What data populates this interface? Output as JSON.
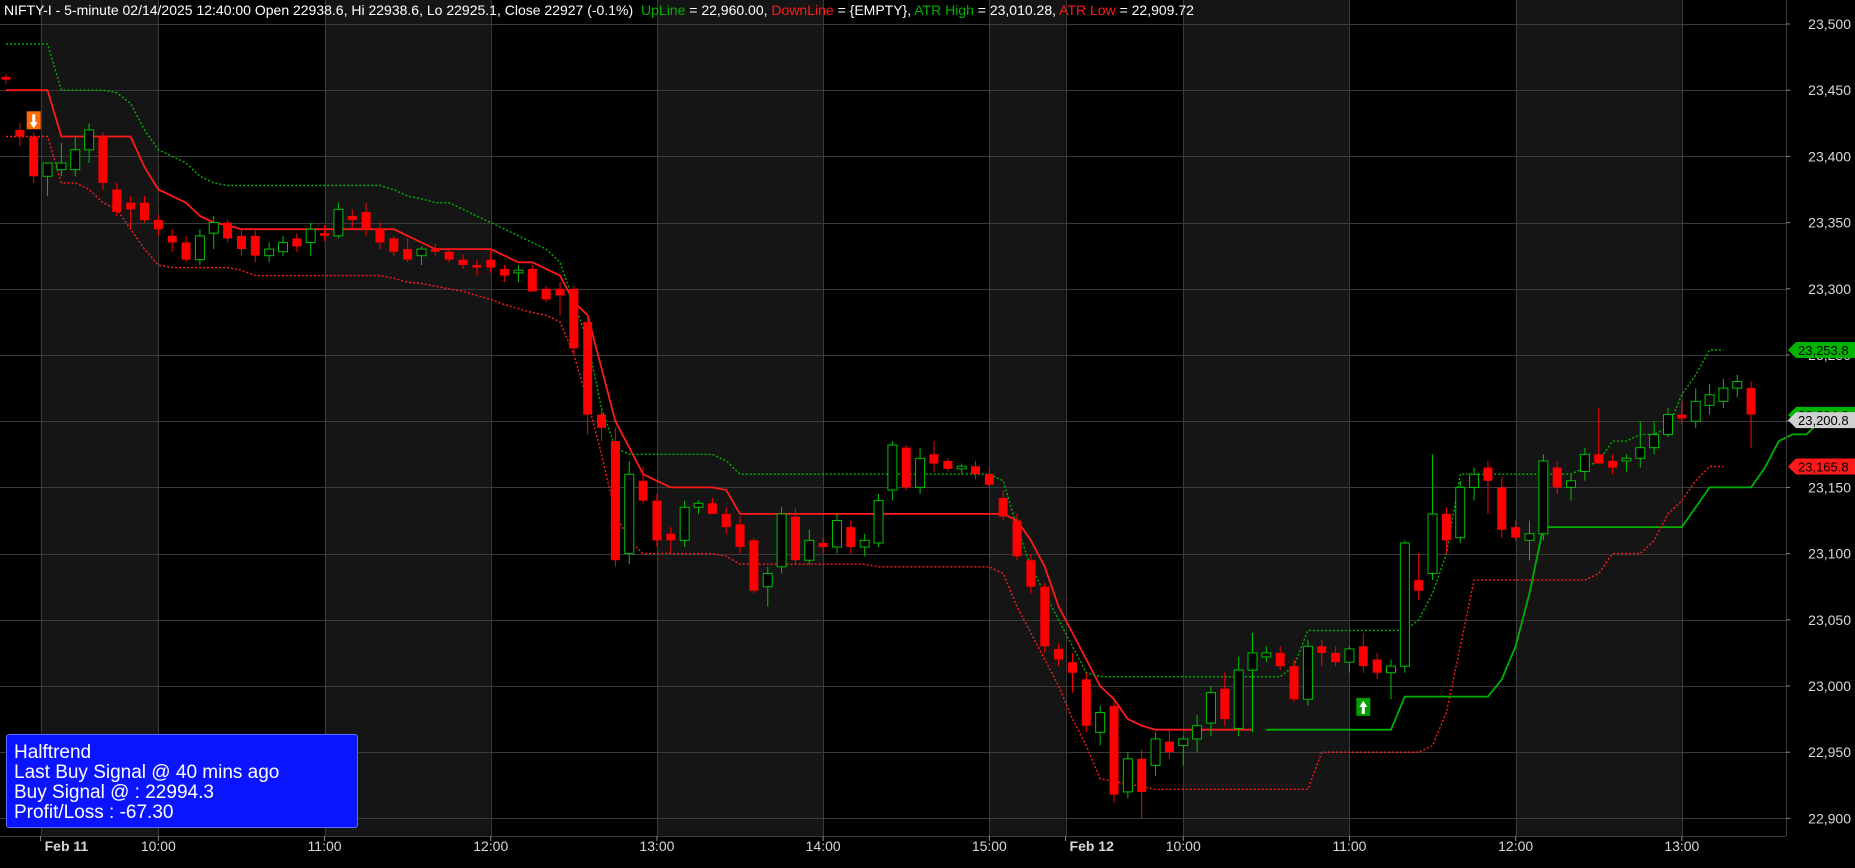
{
  "header": {
    "symbol_line": "NIFTY-I - 5-minute 02/14/2025 12:40:00 Open 22938.6, Hi 22938.6, Lo 22925.1, Close 22927 (-0.1%)",
    "upline_label": "UpLine",
    "upline_value": " = 22,960.00, ",
    "downline_label": "DownLine",
    "downline_value": " = {EMPTY}, ",
    "atrhigh_label": "ATR High",
    "atrhigh_value": " = 23,010.28, ",
    "atrlow_label": "ATR Low",
    "atrlow_value": " = 22,909.72"
  },
  "info_box": {
    "title": "Halftrend",
    "line1": "Last Buy Signal @ 40 mins ago",
    "line2": "Buy Signal @  : 22994.3",
    "line3": "Profit/Loss : -67.30"
  },
  "colors": {
    "background": "#000000",
    "band_alt": "#151515",
    "grid": "#3a3a3a",
    "bull": "#00c000",
    "bear": "#ff0000",
    "upline": "#00b000",
    "downline": "#ff1a1a",
    "atr_high": "#00b400",
    "atr_low": "#ff1a1a",
    "info_bg": "#0a14ff",
    "text": "#d8d8d8"
  },
  "chart_data": {
    "type": "candlestick",
    "title": "NIFTY-I - 5-minute",
    "y_ticks": [
      "23,500",
      "23,450",
      "23,400",
      "23,350",
      "23,300",
      "23,250",
      "23,200",
      "23,150",
      "23,100",
      "23,050",
      "23,000",
      "22,950",
      "22,900"
    ],
    "y_tick_values": [
      23500,
      23450,
      23400,
      23350,
      23300,
      23250,
      23200,
      23150,
      23100,
      23050,
      23000,
      22950,
      22900
    ],
    "ylim": [
      22888,
      23515
    ],
    "x_tick_labels": [
      {
        "label": "Feb 11",
        "bar": 2.5,
        "bold": true
      },
      {
        "label": "10:00",
        "bar": 11
      },
      {
        "label": "11:00",
        "bar": 23
      },
      {
        "label": "12:00",
        "bar": 35
      },
      {
        "label": "13:00",
        "bar": 47
      },
      {
        "label": "14:00",
        "bar": 59
      },
      {
        "label": "15:00",
        "bar": 71
      },
      {
        "label": "Feb 12",
        "bar": 76.5,
        "bold": true
      },
      {
        "label": "10:00",
        "bar": 85
      },
      {
        "label": "11:00",
        "bar": 97
      },
      {
        "label": "12:00",
        "bar": 109
      },
      {
        "label": "13:00",
        "bar": 121
      }
    ],
    "right_tags": [
      {
        "text": "23,253.8",
        "value": 23253.8,
        "bg": "#00b400",
        "fg": "#000000"
      },
      {
        "text": "23,204.8",
        "value": 23204.8,
        "bg": "#00b400",
        "fg": "#000000"
      },
      {
        "text": "23,200.8",
        "value": 23200.8,
        "bg": "#d0d0d0",
        "fg": "#000000"
      },
      {
        "text": "23,165.8",
        "value": 23165.8,
        "bg": "#ff1a1a",
        "fg": "#000000"
      }
    ],
    "signals": [
      {
        "type": "sell",
        "bar": 2,
        "value": 23425
      },
      {
        "type": "buy",
        "bar": 98,
        "value": 22985
      }
    ],
    "candles": [
      [
        23460,
        23462,
        23455,
        23458
      ],
      [
        23420,
        23425,
        23408,
        23415
      ],
      [
        23415,
        23418,
        23380,
        23385
      ],
      [
        23385,
        23395,
        23370,
        23395
      ],
      [
        23390,
        23410,
        23385,
        23395
      ],
      [
        23390,
        23415,
        23385,
        23405
      ],
      [
        23405,
        23425,
        23395,
        23420
      ],
      [
        23415,
        23418,
        23375,
        23380
      ],
      [
        23375,
        23380,
        23355,
        23358
      ],
      [
        23365,
        23370,
        23345,
        23360
      ],
      [
        23365,
        23370,
        23350,
        23352
      ],
      [
        23352,
        23356,
        23340,
        23345
      ],
      [
        23340,
        23345,
        23328,
        23335
      ],
      [
        23335,
        23340,
        23320,
        23322
      ],
      [
        23322,
        23345,
        23318,
        23340
      ],
      [
        23342,
        23355,
        23330,
        23350
      ],
      [
        23350,
        23352,
        23335,
        23338
      ],
      [
        23340,
        23345,
        23325,
        23330
      ],
      [
        23340,
        23344,
        23320,
        23325
      ],
      [
        23325,
        23335,
        23320,
        23330
      ],
      [
        23328,
        23340,
        23325,
        23335
      ],
      [
        23338,
        23342,
        23328,
        23332
      ],
      [
        23335,
        23350,
        23325,
        23345
      ],
      [
        23342,
        23348,
        23336,
        23340
      ],
      [
        23340,
        23365,
        23338,
        23360
      ],
      [
        23355,
        23360,
        23345,
        23352
      ],
      [
        23358,
        23365,
        23340,
        23345
      ],
      [
        23345,
        23350,
        23330,
        23335
      ],
      [
        23338,
        23340,
        23325,
        23328
      ],
      [
        23330,
        23338,
        23320,
        23322
      ],
      [
        23325,
        23332,
        23318,
        23330
      ],
      [
        23330,
        23334,
        23325,
        23328
      ],
      [
        23328,
        23330,
        23320,
        23322
      ],
      [
        23322,
        23326,
        23315,
        23318
      ],
      [
        23318,
        23322,
        23310,
        23316
      ],
      [
        23322,
        23330,
        23312,
        23316
      ],
      [
        23315,
        23318,
        23305,
        23310
      ],
      [
        23312,
        23318,
        23305,
        23314
      ],
      [
        23315,
        23318,
        23298,
        23298
      ],
      [
        23300,
        23302,
        23290,
        23292
      ],
      [
        23300,
        23305,
        23280,
        23295
      ],
      [
        23300,
        23302,
        23250,
        23255
      ],
      [
        23275,
        23280,
        23190,
        23205
      ],
      [
        23205,
        23210,
        23185,
        23195
      ],
      [
        23185,
        23195,
        23090,
        23095
      ],
      [
        23100,
        23170,
        23092,
        23160
      ],
      [
        23155,
        23165,
        23138,
        23140
      ],
      [
        23140,
        23145,
        23105,
        23110
      ],
      [
        23115,
        23120,
        23100,
        23110
      ],
      [
        23110,
        23140,
        23105,
        23135
      ],
      [
        23135,
        23140,
        23130,
        23138
      ],
      [
        23138,
        23142,
        23130,
        23130
      ],
      [
        23130,
        23135,
        23115,
        23120
      ],
      [
        23122,
        23128,
        23100,
        23105
      ],
      [
        23110,
        23112,
        23070,
        23072
      ],
      [
        23075,
        23090,
        23060,
        23085
      ],
      [
        23090,
        23135,
        23085,
        23130
      ],
      [
        23128,
        23134,
        23092,
        23095
      ],
      [
        23095,
        23118,
        23092,
        23110
      ],
      [
        23108,
        23112,
        23100,
        23105
      ],
      [
        23105,
        23130,
        23100,
        23125
      ],
      [
        23120,
        23125,
        23100,
        23105
      ],
      [
        23105,
        23115,
        23098,
        23110
      ],
      [
        23108,
        23145,
        23105,
        23140
      ],
      [
        23148,
        23185,
        23140,
        23182
      ],
      [
        23180,
        23182,
        23148,
        23150
      ],
      [
        23150,
        23180,
        23145,
        23172
      ],
      [
        23175,
        23185,
        23162,
        23168
      ],
      [
        23170,
        23172,
        23162,
        23164
      ],
      [
        23164,
        23168,
        23160,
        23166
      ],
      [
        23166,
        23170,
        23156,
        23160
      ],
      [
        23160,
        23164,
        23150,
        23152
      ],
      [
        23142,
        23148,
        23125,
        23128
      ],
      [
        23125,
        23130,
        23095,
        23098
      ],
      [
        23095,
        23100,
        23070,
        23075
      ],
      [
        23075,
        23078,
        23025,
        23030
      ],
      [
        23028,
        23032,
        23015,
        23020
      ],
      [
        23018,
        23025,
        22995,
        23010
      ],
      [
        23005,
        23010,
        22965,
        22970
      ],
      [
        22965,
        22985,
        22955,
        22980
      ],
      [
        22985,
        22988,
        22912,
        22918
      ],
      [
        22920,
        22950,
        22915,
        22945
      ],
      [
        22945,
        22952,
        22900,
        22920
      ],
      [
        22940,
        22965,
        22932,
        22960
      ],
      [
        22958,
        22968,
        22945,
        22950
      ],
      [
        22955,
        22962,
        22940,
        22960
      ],
      [
        22960,
        22978,
        22950,
        22970
      ],
      [
        22972,
        23000,
        22962,
        22995
      ],
      [
        22998,
        23010,
        22970,
        22975
      ],
      [
        22968,
        23022,
        22962,
        23012
      ],
      [
        23012,
        23040,
        22965,
        23025
      ],
      [
        23022,
        23030,
        23018,
        23025
      ],
      [
        23025,
        23030,
        23012,
        23015
      ],
      [
        23015,
        23020,
        22988,
        22990
      ],
      [
        22990,
        23035,
        22985,
        23030
      ],
      [
        23030,
        23035,
        23015,
        23025
      ],
      [
        23025,
        23030,
        23015,
        23018
      ],
      [
        23018,
        23030,
        23010,
        23028
      ],
      [
        23030,
        23040,
        23010,
        23015
      ],
      [
        23020,
        23025,
        23005,
        23010
      ],
      [
        23010,
        23020,
        22990,
        23015
      ],
      [
        23015,
        23110,
        23010,
        23108
      ],
      [
        23080,
        23100,
        23065,
        23072
      ],
      [
        23085,
        23175,
        23080,
        23130
      ],
      [
        23130,
        23135,
        23100,
        23110
      ],
      [
        23112,
        23155,
        23108,
        23150
      ],
      [
        23150,
        23165,
        23140,
        23160
      ],
      [
        23165,
        23170,
        23130,
        23155
      ],
      [
        23150,
        23158,
        23112,
        23118
      ],
      [
        23120,
        23125,
        23110,
        23112
      ],
      [
        23110,
        23125,
        23095,
        23115
      ],
      [
        23115,
        23175,
        23110,
        23170
      ],
      [
        23165,
        23170,
        23145,
        23150
      ],
      [
        23150,
        23160,
        23140,
        23155
      ],
      [
        23162,
        23180,
        23155,
        23175
      ],
      [
        23175,
        23210,
        23170,
        23168
      ],
      [
        23170,
        23175,
        23160,
        23165
      ],
      [
        23170,
        23175,
        23162,
        23172
      ],
      [
        23172,
        23200,
        23165,
        23180
      ],
      [
        23180,
        23200,
        23175,
        23190
      ],
      [
        23190,
        23210,
        23188,
        23205
      ],
      [
        23205,
        23215,
        23198,
        23202
      ],
      [
        23200,
        23225,
        23195,
        23215
      ],
      [
        23212,
        23228,
        23205,
        23220
      ],
      [
        23215,
        23232,
        23210,
        23225
      ],
      [
        23225,
        23235,
        23218,
        23230
      ],
      [
        23225,
        23230,
        23180,
        23205
      ]
    ],
    "series": [
      {
        "name": "UpLine",
        "style": "solid",
        "color": "#00b000",
        "start": 91,
        "values": [
          22967,
          22967,
          22967,
          22967,
          22967,
          22967,
          22967,
          22967,
          22967,
          22967,
          22992,
          22992,
          22992,
          22992,
          22992,
          22992,
          22992,
          23005,
          23030,
          23070,
          23120,
          23120,
          23120,
          23120,
          23120,
          23120,
          23120,
          23120,
          23120,
          23120,
          23120,
          23135,
          23150,
          23150,
          23150,
          23150,
          23165,
          23185,
          23190,
          23190,
          23200
        ]
      },
      {
        "name": "DownLine",
        "style": "solid",
        "color": "#ff1a1a",
        "start": 0,
        "values": [
          23450,
          23450,
          23450,
          23450,
          23415,
          23415,
          23415,
          23415,
          23415,
          23415,
          23392,
          23375,
          23370,
          23365,
          23355,
          23350,
          23348,
          23345,
          23345,
          23345,
          23345,
          23345,
          23345,
          23345,
          23345,
          23345,
          23345,
          23345,
          23345,
          23340,
          23335,
          23330,
          23330,
          23330,
          23330,
          23330,
          23325,
          23320,
          23320,
          23315,
          23310,
          23290,
          23280,
          23240,
          23200,
          23180,
          23160,
          23155,
          23150,
          23150,
          23150,
          23150,
          23148,
          23130,
          23130,
          23130,
          23130,
          23130,
          23130,
          23130,
          23130,
          23130,
          23130,
          23130,
          23130,
          23130,
          23130,
          23130,
          23130,
          23130,
          23130,
          23130,
          23130,
          23125,
          23110,
          23090,
          23060,
          23040,
          23020,
          23000,
          22990,
          22975,
          22970,
          22967,
          22967,
          22967,
          22967,
          22967,
          22967,
          22967,
          22967
        ]
      },
      {
        "name": "ATR High",
        "style": "dotted",
        "color": "#00b400",
        "start": 0,
        "values": [
          23485,
          23485,
          23485,
          23485,
          23450,
          23450,
          23450,
          23450,
          23448,
          23440,
          23420,
          23405,
          23400,
          23395,
          23385,
          23380,
          23378,
          23378,
          23378,
          23378,
          23378,
          23378,
          23378,
          23378,
          23378,
          23378,
          23378,
          23378,
          23375,
          23370,
          23368,
          23365,
          23365,
          23360,
          23355,
          23350,
          23345,
          23340,
          23335,
          23330,
          23320,
          23290,
          23260,
          23210,
          23180,
          23175,
          23175,
          23175,
          23175,
          23175,
          23175,
          23175,
          23170,
          23160,
          23160,
          23160,
          23160,
          23160,
          23160,
          23160,
          23160,
          23160,
          23160,
          23160,
          23160,
          23160,
          23160,
          23160,
          23160,
          23160,
          23160,
          23160,
          23155,
          23120,
          23090,
          23070,
          23050,
          23030,
          23010,
          23007,
          23007,
          23007,
          23007,
          23007,
          23007,
          23007,
          23007,
          23007,
          23007,
          23007,
          23007,
          23007,
          23007,
          23015,
          23042,
          23042,
          23042,
          23042,
          23042,
          23042,
          23042,
          23042,
          23050,
          23070,
          23100,
          23160,
          23160,
          23160,
          23160,
          23160,
          23160,
          23160,
          23160,
          23160,
          23165,
          23170,
          23185,
          23185,
          23190,
          23190,
          23195,
          23220,
          23235,
          23253.8,
          23253.8
        ]
      },
      {
        "name": "ATR Low",
        "style": "dotted",
        "color": "#ff1a1a",
        "start": 0,
        "values": [
          23415,
          23415,
          23415,
          23415,
          23380,
          23380,
          23375,
          23365,
          23360,
          23345,
          23330,
          23318,
          23316,
          23316,
          23316,
          23316,
          23316,
          23314,
          23310,
          23310,
          23310,
          23310,
          23310,
          23310,
          23310,
          23310,
          23310,
          23310,
          23308,
          23305,
          23304,
          23302,
          23300,
          23298,
          23295,
          23292,
          23288,
          23285,
          23282,
          23280,
          23275,
          23250,
          23215,
          23175,
          23130,
          23110,
          23100,
          23100,
          23100,
          23100,
          23100,
          23100,
          23098,
          23092,
          23092,
          23092,
          23092,
          23092,
          23092,
          23092,
          23092,
          23092,
          23092,
          23090,
          23090,
          23090,
          23090,
          23090,
          23090,
          23090,
          23090,
          23090,
          23085,
          23060,
          23040,
          23020,
          23000,
          22975,
          22955,
          22930,
          22928,
          22926,
          22924,
          22922,
          22922,
          22922,
          22922,
          22922,
          22922,
          22922,
          22922,
          22922,
          22922,
          22922,
          22922,
          22950,
          22950,
          22950,
          22950,
          22950,
          22950,
          22950,
          22950,
          22955,
          22980,
          23030,
          23080,
          23080,
          23080,
          23080,
          23080,
          23080,
          23080,
          23080,
          23080,
          23085,
          23100,
          23100,
          23100,
          23110,
          23130,
          23140,
          23155,
          23165.8,
          23165.8
        ]
      }
    ]
  }
}
